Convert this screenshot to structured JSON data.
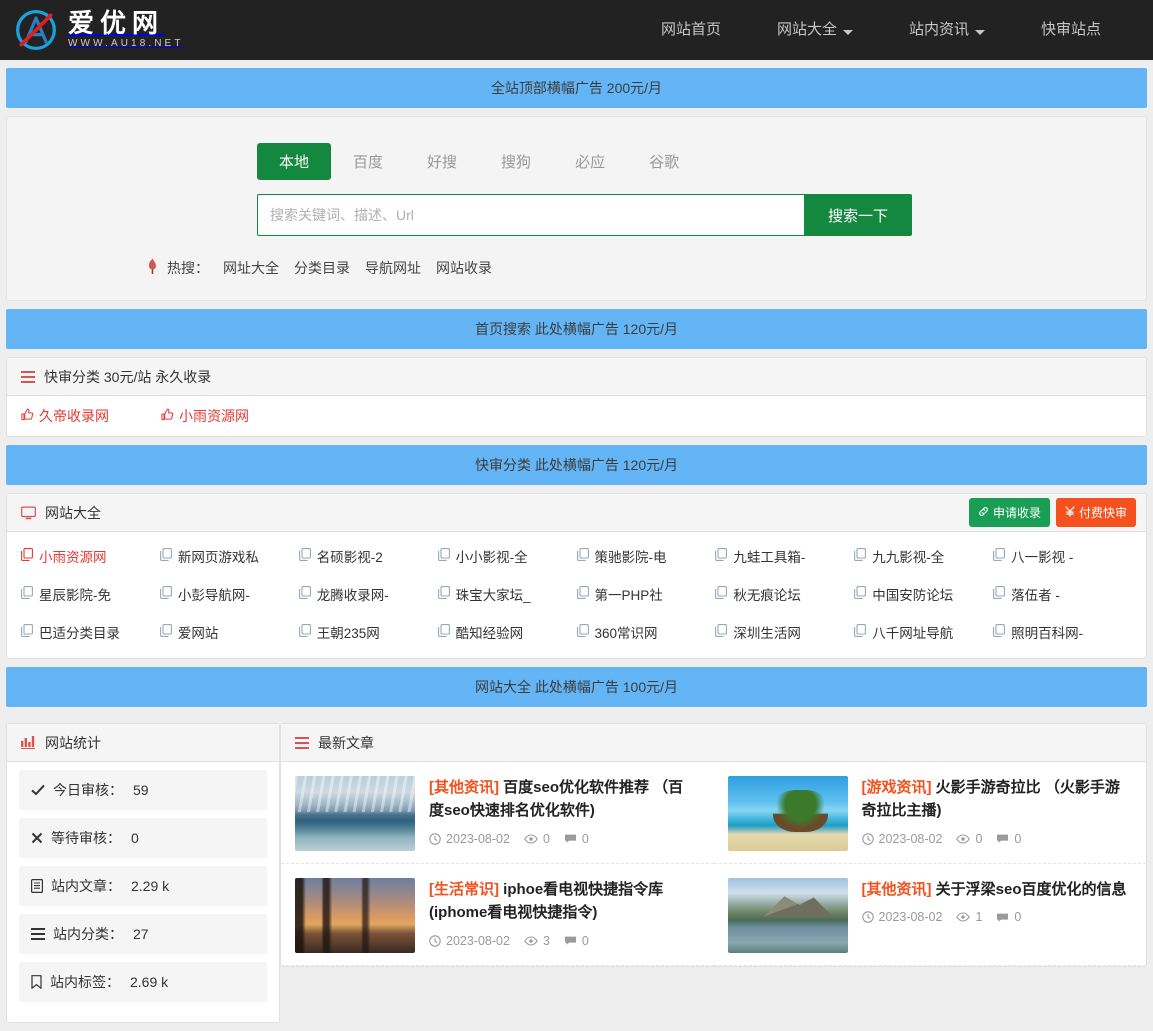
{
  "site": {
    "brand_name": "爱优网",
    "brand_url": "WWW.AU18.NET",
    "logo_icon": "logo-a-circle-icon"
  },
  "nav": {
    "items": [
      {
        "label": "网站首页",
        "has_caret": false
      },
      {
        "label": "网站大全",
        "has_caret": true
      },
      {
        "label": "站内资讯",
        "has_caret": true
      },
      {
        "label": "快审站点",
        "has_caret": false
      }
    ]
  },
  "ads": {
    "top_banner": "全站顶部横幅广告 200元/月",
    "home_search_banner": "首页搜索 此处横幅广告 120元/月",
    "quick_audit_banner": "快审分类 此处横幅广告 120元/月",
    "directory_banner": "网站大全 此处横幅广告 100元/月"
  },
  "search": {
    "engines": [
      "本地",
      "百度",
      "好搜",
      "搜狗",
      "必应",
      "谷歌"
    ],
    "active_engine": "本地",
    "placeholder": "搜索关键词、描述、Url",
    "value": "",
    "button_label": "搜索一下",
    "hot_icon": "fire-icon",
    "hot_label": "热搜：",
    "hot_keywords": [
      "网址大全",
      "分类目录",
      "导航网址",
      "网站收录"
    ]
  },
  "quick_audit": {
    "icon": "menu-lines-icon",
    "title": "快审分类 30元/站 永久收录",
    "links": [
      {
        "icon": "thumbs-up-icon",
        "label": "久帝收录网"
      },
      {
        "icon": "thumbs-up-icon",
        "label": "小雨资源网"
      }
    ]
  },
  "directory": {
    "icon": "monitor-icon",
    "title": "网站大全",
    "actions": [
      {
        "icon": "link-icon",
        "label": "申请收录",
        "color": "#1a9e55"
      },
      {
        "icon": "yen-icon",
        "label": "付费快审",
        "color": "#f4511e"
      }
    ],
    "sites": [
      {
        "label": "小雨资源网",
        "highlight": true
      },
      {
        "label": "新网页游戏私",
        "highlight": false
      },
      {
        "label": "名硕影视-2",
        "highlight": false
      },
      {
        "label": "小小影视-全",
        "highlight": false
      },
      {
        "label": "策驰影院-电",
        "highlight": false
      },
      {
        "label": "九蛙工具箱-",
        "highlight": false
      },
      {
        "label": "九九影视-全",
        "highlight": false
      },
      {
        "label": "八一影视 -",
        "highlight": false
      },
      {
        "label": "星辰影院-免",
        "highlight": false
      },
      {
        "label": "小彭导航网-",
        "highlight": false
      },
      {
        "label": "龙腾收录网-",
        "highlight": false
      },
      {
        "label": "珠宝大家坛_",
        "highlight": false
      },
      {
        "label": "第一PHP社",
        "highlight": false
      },
      {
        "label": "秋无痕论坛",
        "highlight": false
      },
      {
        "label": "中国安防论坛",
        "highlight": false
      },
      {
        "label": "落伍者 -",
        "highlight": false
      },
      {
        "label": "巴适分类目录",
        "highlight": false
      },
      {
        "label": "爱网站",
        "highlight": false
      },
      {
        "label": "王朝235网",
        "highlight": false
      },
      {
        "label": "酷知经验网",
        "highlight": false
      },
      {
        "label": "360常识网",
        "highlight": false
      },
      {
        "label": "深圳生活网",
        "highlight": false
      },
      {
        "label": "八千网址导航",
        "highlight": false
      },
      {
        "label": "照明百科网-",
        "highlight": false
      }
    ]
  },
  "stats": {
    "icon": "bar-chart-icon",
    "title": "网站统计",
    "items": [
      {
        "icon": "check-icon",
        "label": "今日审核：",
        "value": "59"
      },
      {
        "icon": "cross-icon",
        "label": "等待审核：",
        "value": "0"
      },
      {
        "icon": "file-icon",
        "label": "站内文章：",
        "value": "2.29 k"
      },
      {
        "icon": "menu-lines-icon",
        "label": "站内分类：",
        "value": "27"
      },
      {
        "icon": "bookmark-icon",
        "label": "站内标签：",
        "value": "2.69 k"
      }
    ]
  },
  "news": {
    "icon": "menu-lines-icon",
    "title": "最新文章",
    "meta_icons": {
      "date": "clock-icon",
      "views": "eye-icon",
      "comments": "comment-icon"
    },
    "articles": [
      {
        "category": "[其他资讯]",
        "title": "百度seo优化软件推荐 （百度seo快速排名优化软件)",
        "date": "2023-08-02",
        "views": "0",
        "comments": "0",
        "thumb": "thumb-clouds"
      },
      {
        "category": "[游戏资讯]",
        "title": "火影手游奇拉比 （火影手游奇拉比主播)",
        "date": "2023-08-02",
        "views": "0",
        "comments": "0",
        "thumb": "thumb-beach"
      },
      {
        "category": "[生活常识]",
        "title": "iphoe看电视快捷指令库 (iphome看电视快捷指令)",
        "date": "2023-08-02",
        "views": "3",
        "comments": "0",
        "thumb": "thumb-sunset"
      },
      {
        "category": "[其他资讯]",
        "title": "关于浮梁seo百度优化的信息",
        "date": "2023-08-02",
        "views": "1",
        "comments": "0",
        "thumb": "thumb-lake"
      }
    ]
  }
}
